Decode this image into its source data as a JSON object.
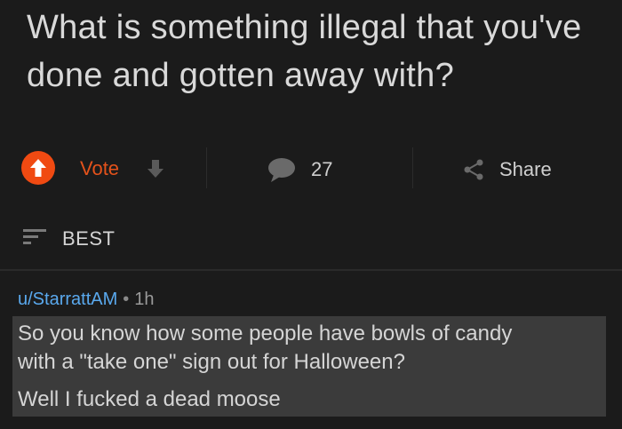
{
  "post": {
    "title": "What is something illegal that you've done and gotten away with?"
  },
  "actions": {
    "vote_label": "Vote",
    "comments_count": "27",
    "share_label": "Share"
  },
  "sort": {
    "label": "BEST"
  },
  "comment": {
    "author": "u/StarrattAM",
    "separator": "•",
    "age": "1h",
    "paragraphs": [
      "So you know how some people have bowls of candy",
      "with a \"take one\" sign out for Halloween?",
      "Well I fucked a dead moose"
    ]
  },
  "colors": {
    "background": "#1b1b1b",
    "upvote_accent": "#f04a12",
    "vote_text": "#e4521b",
    "username": "#5aa9ee",
    "comment_highlight": "#3b3b3b"
  }
}
